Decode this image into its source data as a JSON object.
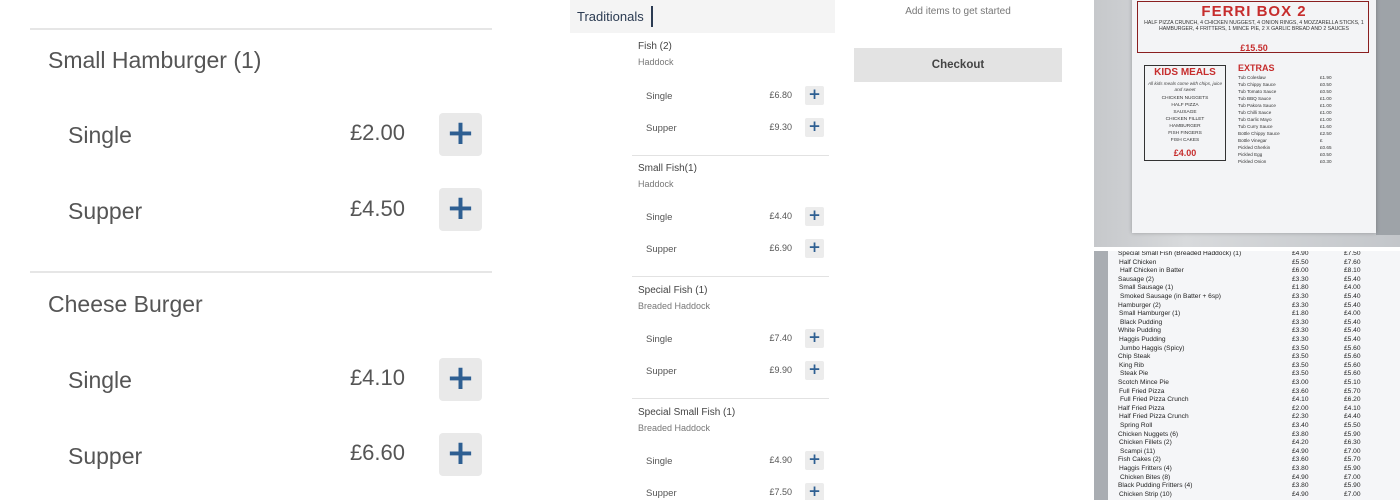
{
  "zoom": {
    "sections": [
      {
        "title": "Small Hamburger (1)",
        "options": [
          {
            "name": "Single",
            "price": "£2.00"
          },
          {
            "name": "Supper",
            "price": "£4.50"
          }
        ]
      },
      {
        "title": "Cheese Burger",
        "options": [
          {
            "name": "Single",
            "price": "£4.10"
          },
          {
            "name": "Supper",
            "price": "£6.60"
          }
        ]
      }
    ],
    "add_glyph": "+"
  },
  "order": {
    "tab_label": "Traditionals",
    "items": [
      {
        "title": "Fish (2)",
        "subtitle": "Haddock",
        "options": [
          {
            "name": "Single",
            "price": "£6.80"
          },
          {
            "name": "Supper",
            "price": "£9.30"
          }
        ]
      },
      {
        "title": "Small Fish(1)",
        "subtitle": "Haddock",
        "options": [
          {
            "name": "Single",
            "price": "£4.40"
          },
          {
            "name": "Supper",
            "price": "£6.90"
          }
        ]
      },
      {
        "title": "Special Fish (1)",
        "subtitle": "Breaded Haddock",
        "options": [
          {
            "name": "Single",
            "price": "£7.40"
          },
          {
            "name": "Supper",
            "price": "£9.90"
          }
        ]
      },
      {
        "title": "Special Small Fish (1)",
        "subtitle": "Breaded Haddock",
        "options": [
          {
            "name": "Single",
            "price": "£4.90"
          },
          {
            "name": "Supper",
            "price": "£7.50"
          }
        ]
      }
    ],
    "add_glyph": "+"
  },
  "basket": {
    "empty_text": "Add items to get started",
    "checkout_label": "Checkout"
  },
  "board": {
    "ferri_title": "FERRI BOX 2",
    "ferri_desc": "HALF PIZZA CRUNCH, 4 CHICKEN NUGGEST, 4 ONION RINGS, 4 MOZZARELLA STICKS, 1 HAMBURGER, 4 FRITTERS, 1 MINCE PIE, 2 X GARLIC BREAD AND 2 SAUCES",
    "ferri_price": "£15.50",
    "kids_title": "KIDS MEALS",
    "kids_note": "All kids meals come with chips, juice and sweet",
    "kids_items": [
      "CHICKEN NUGGETS",
      "HALF PIZZA",
      "SAUSAGE",
      "CHICKEN FILLET",
      "HAMBURGER",
      "FISH FINGERS",
      "FISH CAKES"
    ],
    "kids_price": "£4.00",
    "extras_title": "EXTRAS",
    "extras": [
      {
        "name": "Tub Coleslaw",
        "price": "£1.90"
      },
      {
        "name": "Tub Chippy Sauce",
        "price": "£0.50"
      },
      {
        "name": "Tub Tomato Sauce",
        "price": "£0.50"
      },
      {
        "name": "Tub BBQ Sauce",
        "price": "£1.00"
      },
      {
        "name": "Tub Pakora Sauce",
        "price": "£1.00"
      },
      {
        "name": "Tub Chilli Sauce",
        "price": "£1.00"
      },
      {
        "name": "Tub Garlic Mayo",
        "price": "£1.00"
      },
      {
        "name": "Tub Curry Sauce",
        "price": "£1.60"
      },
      {
        "name": "Bottle Chippy Sauce",
        "price": "£2.50"
      },
      {
        "name": "Bottle Vinegar",
        "price": "£"
      },
      {
        "name": "Pickled Gherkin",
        "price": "£0.65"
      },
      {
        "name": "Pickled Egg",
        "price": "£0.50"
      },
      {
        "name": "Pickled Onion",
        "price": "£0.30"
      }
    ]
  },
  "price_list": [
    {
      "name": "Special Small Fish (Breaded Haddock) (1)",
      "single": "£4.90",
      "supper": "£7.50"
    },
    {
      "name": "Half Chicken",
      "single": "£5.50",
      "supper": "£7.60"
    },
    {
      "name": "Half Chicken in Batter",
      "single": "£6.00",
      "supper": "£8.10"
    },
    {
      "name": "Sausage (2)",
      "single": "£3.30",
      "supper": "£5.40"
    },
    {
      "name": "Small Sausage (1)",
      "single": "£1.80",
      "supper": "£4.00"
    },
    {
      "name": "Smoked Sausage (in Batter + 6sp)",
      "single": "£3.30",
      "supper": "£5.40"
    },
    {
      "name": "Hamburger (2)",
      "single": "£3.30",
      "supper": "£5.40"
    },
    {
      "name": "Small Hamburger (1)",
      "single": "£1.80",
      "supper": "£4.00"
    },
    {
      "name": "Black Pudding",
      "single": "£3.30",
      "supper": "£5.40"
    },
    {
      "name": "White Pudding",
      "single": "£3.30",
      "supper": "£5.40"
    },
    {
      "name": "Haggis Pudding",
      "single": "£3.30",
      "supper": "£5.40"
    },
    {
      "name": "Jumbo Haggis (Spicy)",
      "single": "£3.50",
      "supper": "£5.60"
    },
    {
      "name": "Chip Steak",
      "single": "£3.50",
      "supper": "£5.60"
    },
    {
      "name": "King Rib",
      "single": "£3.50",
      "supper": "£5.60"
    },
    {
      "name": "Steak Pie",
      "single": "£3.50",
      "supper": "£5.60"
    },
    {
      "name": "Scotch Mince Pie",
      "single": "£3.00",
      "supper": "£5.10"
    },
    {
      "name": "Full Fried Pizza",
      "single": "£3.60",
      "supper": "£5.70"
    },
    {
      "name": "Full Fried Pizza Crunch",
      "single": "£4.10",
      "supper": "£6.20"
    },
    {
      "name": "Half Fried Pizza",
      "single": "£2.00",
      "supper": "£4.10"
    },
    {
      "name": "Half Fried Pizza Crunch",
      "single": "£2.30",
      "supper": "£4.40"
    },
    {
      "name": "Spring Roll",
      "single": "£3.40",
      "supper": "£5.50"
    },
    {
      "name": "Chicken Nuggets (6)",
      "single": "£3.80",
      "supper": "£5.90"
    },
    {
      "name": "Chicken Fillets (2)",
      "single": "£4.20",
      "supper": "£6.30"
    },
    {
      "name": "Scampi (11)",
      "single": "£4.90",
      "supper": "£7.00"
    },
    {
      "name": "Fish Cakes (2)",
      "single": "£3.60",
      "supper": "£5.70"
    },
    {
      "name": "Haggis Fritters (4)",
      "single": "£3.80",
      "supper": "£5.90"
    },
    {
      "name": "Chicken Bites (8)",
      "single": "£4.90",
      "supper": "£7.00"
    },
    {
      "name": "Black Pudding Fritters (4)",
      "single": "£3.80",
      "supper": "£5.90"
    },
    {
      "name": "Chicken Strip (10)",
      "single": "£4.90",
      "supper": "£7.00"
    }
  ]
}
